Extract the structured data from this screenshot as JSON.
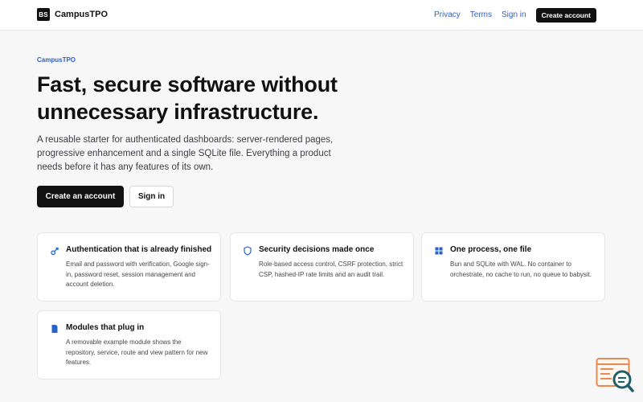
{
  "header": {
    "logo_mark": "BS",
    "brand": "CampusTPO",
    "links": [
      "Privacy",
      "Terms",
      "Sign in"
    ],
    "cta": "Create account"
  },
  "hero": {
    "eyebrow": "CampusTPO",
    "headline": "Fast, secure software without unnecessary infrastructure.",
    "lede": "A reusable starter for authenticated dashboards: server-rendered pages, progressive enhancement and a single SQLite file. Everything a product needs before it has any features of its own.",
    "primary_button": "Create an account",
    "secondary_button": "Sign in"
  },
  "features": [
    {
      "icon": "key-icon",
      "title": "Authentication that is already finished",
      "body": "Email and password with verification, Google sign-in, password reset, session management and account deletion."
    },
    {
      "icon": "shield-icon",
      "title": "Security decisions made once",
      "body": "Role-based access control, CSRF protection, strict CSP, hashed-IP rate limits and an audit trail."
    },
    {
      "icon": "grid-icon",
      "title": "One process, one file",
      "body": "Bun and SQLite with WAL. No container to orchestrate, no cache to run, no queue to babysit."
    },
    {
      "icon": "document-icon",
      "title": "Modules that plug in",
      "body": "A removable example module shows the repository, service, route and view pattern for new features."
    }
  ],
  "colors": {
    "accent": "#2f5fc4",
    "icon_blue": "#2563c9",
    "dark": "#111111",
    "background": "#f7f7f8",
    "widget_orange": "#e98a55",
    "widget_teal": "#1f5f6b"
  },
  "widget": {
    "icon": "debug-inspector-icon"
  }
}
